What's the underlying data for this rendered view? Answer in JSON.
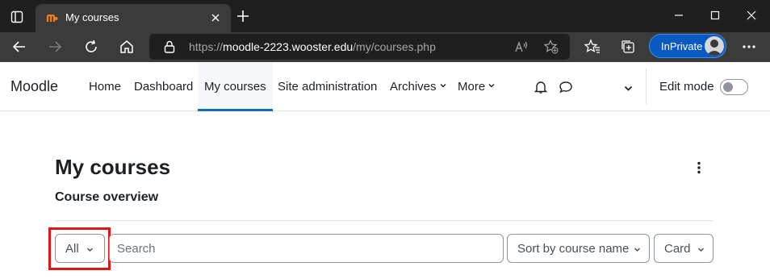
{
  "browser": {
    "tab_title": "My courses",
    "url_scheme": "https://",
    "url_host": "moodle-2223.wooster.edu",
    "url_path": "/my/courses.php",
    "inprivate_label": "InPrivate"
  },
  "navbar": {
    "brand": "Moodle",
    "items": [
      {
        "label": "Home"
      },
      {
        "label": "Dashboard"
      },
      {
        "label": "My courses",
        "active": true
      },
      {
        "label": "Site administration"
      },
      {
        "label": "Archives"
      },
      {
        "label": "More"
      }
    ],
    "edit_mode_label": "Edit mode",
    "edit_mode_on": false
  },
  "page": {
    "title": "My courses",
    "block_title": "Course overview",
    "filter_selected": "All",
    "search_placeholder": "Search",
    "sort_selected": "Sort by course name",
    "view_selected": "Card"
  },
  "colors": {
    "accent": "#0f6cbf",
    "highlight": "#e11515",
    "inprivate": "#0a5ac2"
  }
}
